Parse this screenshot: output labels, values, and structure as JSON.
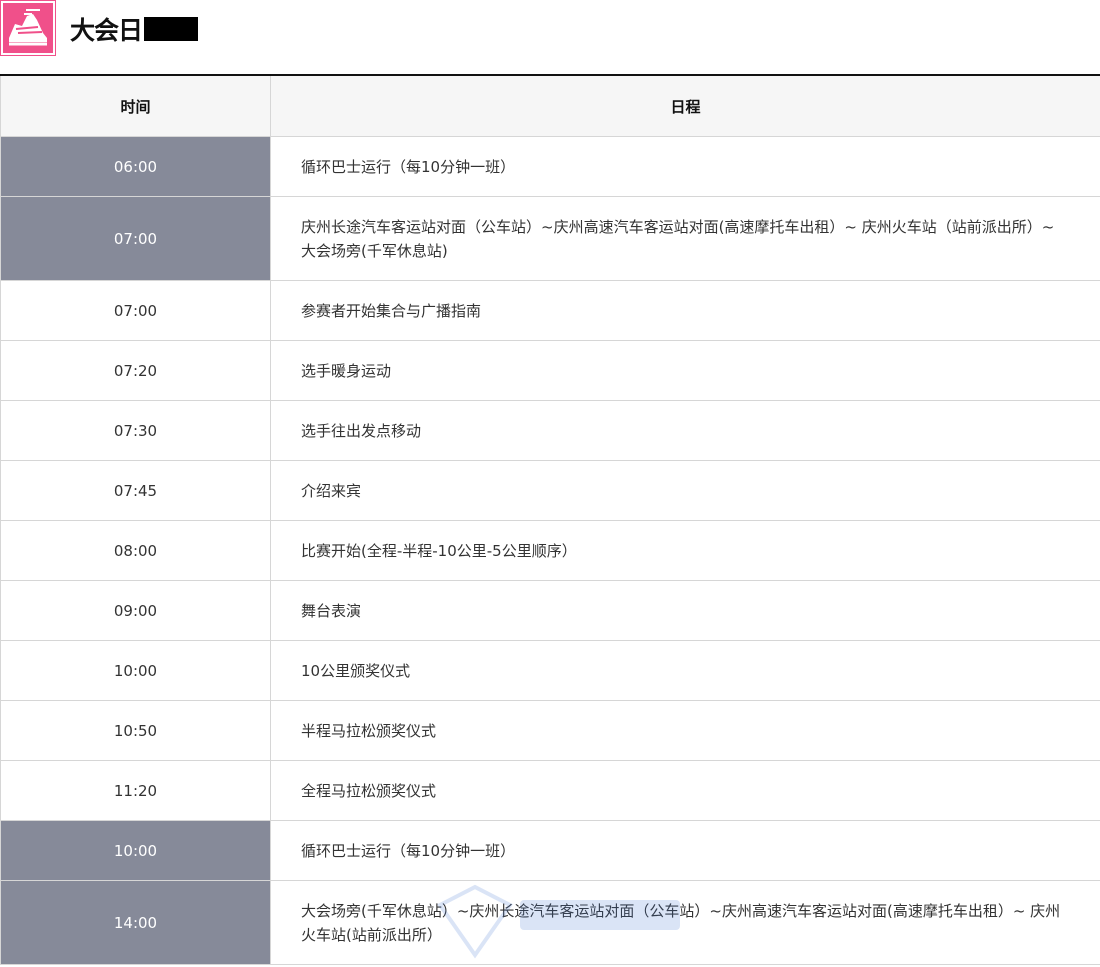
{
  "header": {
    "title": "大会日"
  },
  "table": {
    "headers": {
      "time": "时间",
      "schedule": "日程"
    },
    "rows": [
      {
        "time": "06:00",
        "text": "循环巴士运行（每10分钟一班）",
        "highlight": true
      },
      {
        "time": "07:00",
        "text": "庆州长途汽车客运站对面（公车站）~庆州高速汽车客运站对面(高速摩托车出租）~ 庆州火车站（站前派出所）~ 大会场旁(千军休息站)",
        "highlight": true
      },
      {
        "time": "07:00",
        "text": "参赛者开始集合与广播指南",
        "highlight": false
      },
      {
        "time": "07:20",
        "text": "选手暖身运动",
        "highlight": false
      },
      {
        "time": "07:30",
        "text": "选手往出发点移动",
        "highlight": false
      },
      {
        "time": "07:45",
        "text": "介绍来宾",
        "highlight": false
      },
      {
        "time": "08:00",
        "text": "比赛开始(全程-半程-10公里-5公里顺序）",
        "highlight": false
      },
      {
        "time": "09:00",
        "text": "舞台表演",
        "highlight": false
      },
      {
        "time": "10:00",
        "text": "10公里颁奖仪式",
        "highlight": false
      },
      {
        "time": "10:50",
        "text": "半程马拉松颁奖仪式",
        "highlight": false
      },
      {
        "time": "11:20",
        "text": "全程马拉松颁奖仪式",
        "highlight": false
      },
      {
        "time": "10:00",
        "text": "循环巴士运行（每10分钟一班）",
        "highlight": true
      },
      {
        "time": "14:00",
        "text": "大会场旁(千军休息站）~庆州长途汽车客运站对面（公车站）~庆州高速汽车客运站对面(高速摩托车出租）~ 庆州火车站(站前派出所）",
        "highlight": true
      }
    ]
  },
  "colors": {
    "logo": "#f0508a",
    "highlight_cell": "#868a99",
    "header_bg": "#f6f6f6"
  },
  "icons": {
    "logo": "running-shoe-icon"
  }
}
